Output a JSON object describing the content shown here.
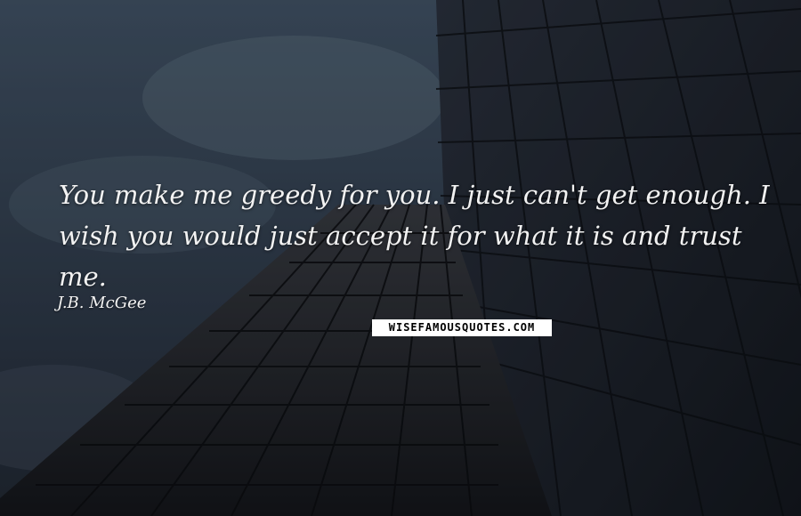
{
  "quote": {
    "text": "You make me greedy for you. I just can't get enough. I wish you would just accept it for what it is and trust me.",
    "author": "J.B. McGee"
  },
  "watermark": {
    "text": "WISEFAMOUSQUOTES.COM"
  },
  "colors": {
    "sky_top": "#3b4c5e",
    "building_glass": "#1b2230",
    "text": "#f2f2f2",
    "watermark_bg": "#ffffff"
  }
}
